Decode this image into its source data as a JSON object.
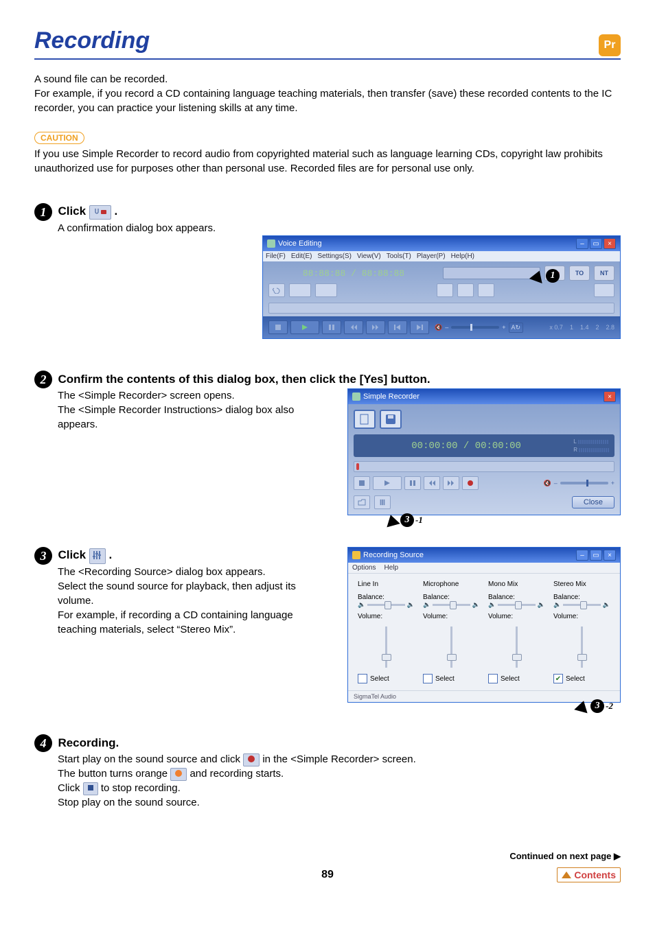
{
  "badge": "Pr",
  "title": "Recording",
  "intro": "A sound file can be recorded.\nFor example, if you record a CD containing language teaching materials, then transfer (save) these recorded contents to the IC recorder, you can practice your listening skills at any time.",
  "caution_label": "CAUTION",
  "caution_text": "If you use Simple Recorder to record audio from copyrighted material such as language learning CDs, copyright law prohibits unauthorized use for purposes other than personal use. Recorded files are for personal use only.",
  "steps": {
    "s1": {
      "num": "1",
      "head_prefix": "Click ",
      "head_suffix": ".",
      "body": "A confirmation dialog box appears."
    },
    "s2": {
      "num": "2",
      "head": "Confirm the contents of this dialog box, then click the [Yes] button.",
      "body": "The <Simple Recorder> screen opens.\nThe <Simple Recorder Instructions> dialog box also appears."
    },
    "s3": {
      "num": "3",
      "head_prefix": "Click ",
      "head_suffix": ".",
      "body": "The <Recording Source> dialog box appears.\nSelect the sound source for playback, then adjust its volume.\nFor example, if recording a CD containing language teaching materials, select “Stereo Mix”."
    },
    "s4": {
      "num": "4",
      "head": "Recording.",
      "line1_a": "Start play on the sound source and click ",
      "line1_b": " in the <Simple Recorder> screen.",
      "line2_a": "The button turns orange ",
      "line2_b": " and recording starts.",
      "line3_a": "Click ",
      "line3_b": " to stop recording.",
      "line4": "Stop play on the sound source."
    }
  },
  "voice_editing": {
    "title": "Voice Editing",
    "menus": [
      "File(F)",
      "Edit(E)",
      "Settings(S)",
      "View(V)",
      "Tools(T)",
      "Player(P)",
      "Help(H)"
    ],
    "time": "88:88:88 / 88:88:88",
    "badge_to": "TO",
    "badge_nt": "NT",
    "speeds": [
      "x 0.7",
      "1",
      "1.4",
      "2",
      "2.8"
    ]
  },
  "simple_recorder": {
    "title": "Simple Recorder",
    "time": "00:00:00 / 00:00:00",
    "level_labels": [
      "L",
      "R"
    ],
    "close": "Close"
  },
  "recording_source": {
    "title": "Recording Source",
    "menus": [
      "Options",
      "Help"
    ],
    "columns": [
      "Line In",
      "Microphone",
      "Mono Mix",
      "Stereo Mix"
    ],
    "balance_label": "Balance:",
    "volume_label": "Volume:",
    "select_label": "Select",
    "select_checked_index": 3,
    "footer": "SigmaTel Audio"
  },
  "callouts": {
    "c1": "1",
    "c3_1": "3",
    "c3_1_suffix": "-1",
    "c3_2": "3",
    "c3_2_suffix": "-2"
  },
  "continued": "Continued on next page",
  "page_number": "89",
  "contents": "Contents"
}
